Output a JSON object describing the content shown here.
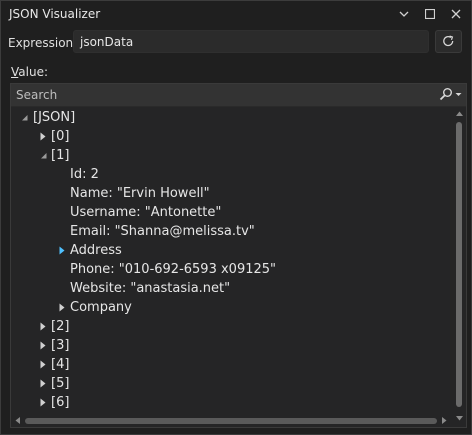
{
  "window": {
    "title": "JSON Visualizer"
  },
  "expression": {
    "label": "Expression:",
    "value": "jsonData"
  },
  "value_section": {
    "label_prefix": "V",
    "label_rest": "alue:"
  },
  "search": {
    "placeholder": "Search"
  },
  "tree": {
    "rows": [
      {
        "text": "[JSON]",
        "level": 0,
        "state": "expanded"
      },
      {
        "text": "[0]",
        "level": 1,
        "state": "collapsed"
      },
      {
        "text": "[1]",
        "level": 1,
        "state": "expanded"
      },
      {
        "text": "Id: 2",
        "level": 2,
        "state": "leaf"
      },
      {
        "text": "Name: \"Ervin Howell\"",
        "level": 2,
        "state": "leaf"
      },
      {
        "text": "Username: \"Antonette\"",
        "level": 2,
        "state": "leaf"
      },
      {
        "text": "Email: \"Shanna@melissa.tv\"",
        "level": 2,
        "state": "leaf"
      },
      {
        "text": "Address",
        "level": 2,
        "state": "collapsed-hover"
      },
      {
        "text": "Phone: \"010-692-6593 x09125\"",
        "level": 2,
        "state": "leaf"
      },
      {
        "text": "Website: \"anastasia.net\"",
        "level": 2,
        "state": "leaf"
      },
      {
        "text": "Company",
        "level": 2,
        "state": "collapsed"
      },
      {
        "text": "[2]",
        "level": 1,
        "state": "collapsed"
      },
      {
        "text": "[3]",
        "level": 1,
        "state": "collapsed"
      },
      {
        "text": "[4]",
        "level": 1,
        "state": "collapsed"
      },
      {
        "text": "[5]",
        "level": 1,
        "state": "collapsed"
      },
      {
        "text": "[6]",
        "level": 1,
        "state": "collapsed"
      }
    ]
  },
  "colors": {
    "accent_arrow": "#4fc1ff",
    "text": "#e6e6e6"
  }
}
